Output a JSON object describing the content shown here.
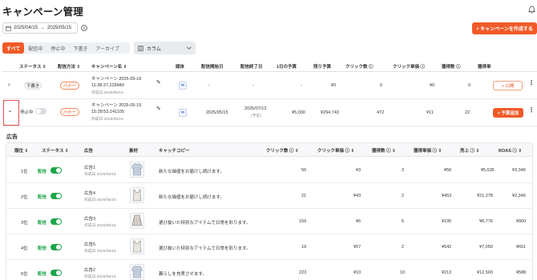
{
  "page": {
    "title": "キャンペーン管理"
  },
  "filters": {
    "date_start": "2025/04/15",
    "date_sep": "→",
    "date_end": "2025/05/15",
    "create_label": "+ キャンペーンを作成する",
    "tabs": [
      "すべて",
      "配信中",
      "停止中",
      "下書き",
      "アーカイブ"
    ],
    "active_tab": "すべて",
    "column_label": "カラム"
  },
  "campaign_table": {
    "headers": {
      "status": "ステータス",
      "method": "配信方法",
      "name": "キャンペーン名",
      "media": "媒体",
      "start": "配信開始日",
      "end": "配信終了日",
      "daily_budget": "1日の予算",
      "remaining": "残り予算",
      "clicks": "クリック数",
      "cpc": "クリック単価",
      "conversions": "獲得数",
      "cpa": "獲得単"
    },
    "rows": [
      {
        "status": "下書き",
        "method": "バナー",
        "name": "キャンペーン 2025-05-16 11:38:37.229949",
        "created": "作成日 2025/05/16",
        "start": "-",
        "end": "-",
        "daily_budget": "-",
        "remaining": "¥0",
        "clicks": "0",
        "cpc": "¥0",
        "conversions": "0",
        "action": "+ 公開"
      },
      {
        "status": "停止中",
        "method": "バナー",
        "name": "キャンペーン 2025-05-15 15:28:53.141105",
        "created": "作成日 2025/05/15",
        "start": "2025/05/15",
        "end": "2025/07/12",
        "end_note": "(予定)",
        "daily_budget": "¥5,000",
        "remaining": "¥294,743",
        "clicks": "472",
        "cpc": "¥11",
        "conversions": "22",
        "action": "+ 予算追加"
      }
    ]
  },
  "ads": {
    "section_title": "広告",
    "headers": {
      "rank": "順位",
      "status": "ステータス",
      "ad": "広告",
      "creative": "素材",
      "copy": "キャッチコピー",
      "clicks": "クリック数",
      "cpc": "クリック単価",
      "conversions": "獲得数",
      "cpa": "獲得単価",
      "sales": "売上",
      "roas": "ROAS"
    },
    "status_label": "配信",
    "rows": [
      {
        "rank": "1位",
        "name": "広告1",
        "created": "作成日 2025/05/15",
        "copy": "新たな価値をお届けし続けます。",
        "clicks": "50",
        "cpc": "¥3",
        "conversions": "3",
        "cpa": "¥56",
        "sales": "¥5,636",
        "roas": "¥3,340",
        "thumb": "shirt"
      },
      {
        "rank": "2位",
        "name": "広告4",
        "created": "作成日 2025/05/15",
        "copy": "新たな価値をお届けし続けます。",
        "clicks": "21",
        "cpc": "¥43",
        "conversions": "2",
        "cpa": "¥453",
        "sales": "¥21,278",
        "roas": "¥2,340",
        "thumb": "tank"
      },
      {
        "rank": "3位",
        "name": "広告3",
        "created": "作成日 2025/05/15",
        "copy": "選び抜いた特別なアイテムで日常を彩ります。",
        "clicks": "159",
        "cpc": "¥6",
        "conversions": "5",
        "cpa": "¥195",
        "sales": "¥8,776",
        "roas": "¥900",
        "thumb": "skirt"
      },
      {
        "rank": "4位",
        "name": "広告5",
        "created": "作成日 2025/05/15",
        "copy": "選び抜いた特別なアイテムで日常を彩ります。",
        "clicks": "19",
        "cpc": "¥57",
        "conversions": "2",
        "cpa": "¥542",
        "sales": "¥7,050",
        "roas": "¥651",
        "thumb": "tank"
      },
      {
        "rank": "5位",
        "name": "広告2",
        "created": "作成日 2025/05/15",
        "copy": "暮らしを充実させます。",
        "clicks": "223",
        "cpc": "¥10",
        "conversions": "10",
        "cpa": "¥213",
        "sales": "¥12,500",
        "roas": "¥588",
        "thumb": "shirt"
      }
    ]
  },
  "colors": {
    "accent": "#f05a28",
    "success": "#1ea64a"
  }
}
